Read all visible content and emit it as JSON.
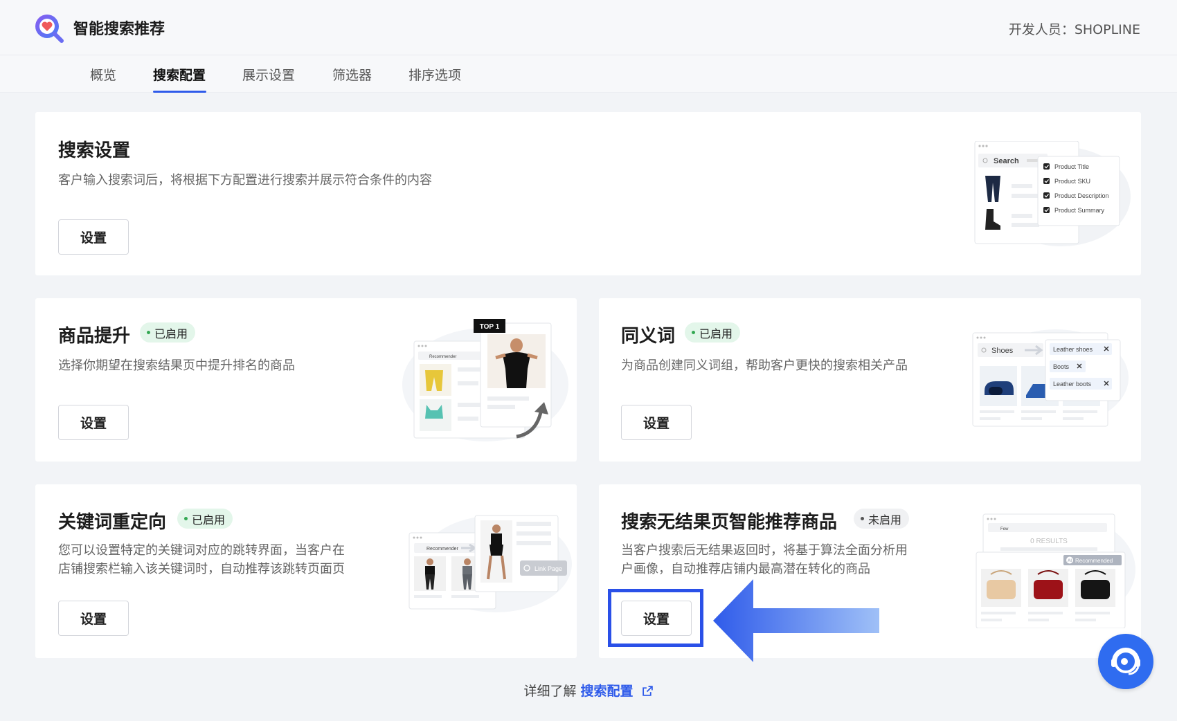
{
  "app": {
    "title": "智能搜索推荐",
    "developer": "开发人员：SHOPLINE",
    "logo_icon": "search-heart-icon"
  },
  "tabs": [
    {
      "label": "概览",
      "active": false
    },
    {
      "label": "搜索配置",
      "active": true
    },
    {
      "label": "展示设置",
      "active": false
    },
    {
      "label": "筛选器",
      "active": false
    },
    {
      "label": "排序选项",
      "active": false
    }
  ],
  "cards": {
    "search_settings": {
      "title": "搜索设置",
      "desc": "客户输入搜索词后，将根据下方配置进行搜索并展示符合条件的内容",
      "button": "设置",
      "illustration": {
        "search_label": "Search",
        "options": [
          "Product Title",
          "Product SKU",
          "Product Description",
          "Product Summary"
        ]
      }
    },
    "product_boost": {
      "title": "商品提升",
      "badge": "已启用",
      "desc": "选择你期望在搜索结果页中提升排名的商品",
      "button": "设置",
      "illustration": {
        "top_label": "TOP 1",
        "header_label": "Recommender"
      }
    },
    "synonyms": {
      "title": "同义词",
      "badge": "已启用",
      "desc": "为商品创建同义词组，帮助客户更快的搜索相关产品",
      "button": "设置",
      "illustration": {
        "search_value": "Shoes",
        "tags": [
          "Leather shoes",
          "Boots",
          "Leather boots"
        ]
      }
    },
    "keyword_redirect": {
      "title": "关键词重定向",
      "badge": "已启用",
      "desc_line1": "您可以设置特定的关键词对应的跳转界面，当客户在",
      "desc_line2": "店铺搜索栏输入该关键词时，自动推荐该跳转页面页",
      "button": "设置",
      "illustration": {
        "header_label": "Recommender",
        "link_label": "Link Page"
      }
    },
    "no_results": {
      "title": "搜索无结果页智能推荐商品",
      "badge": "未启用",
      "desc_line1": "当客户搜索后无结果返回时，将基于算法全面分析用",
      "desc_line2": "户画像，自动推荐店铺内最高潜在转化的商品",
      "button": "设置",
      "illustration": {
        "search_value": "Few",
        "results_label": "0 RESULTS",
        "ai_label": "Recommended",
        "ai_badge": "AI"
      }
    }
  },
  "footer": {
    "prefix": "详细了解",
    "link": "搜索配置",
    "link_icon": "external-link-icon"
  },
  "support_icon": "customer-support-icon",
  "colors": {
    "accent": "#2f5bea",
    "enabled_bg": "#e3f6ea",
    "enabled_dot": "#34a853",
    "highlight": "#2a50e8"
  }
}
